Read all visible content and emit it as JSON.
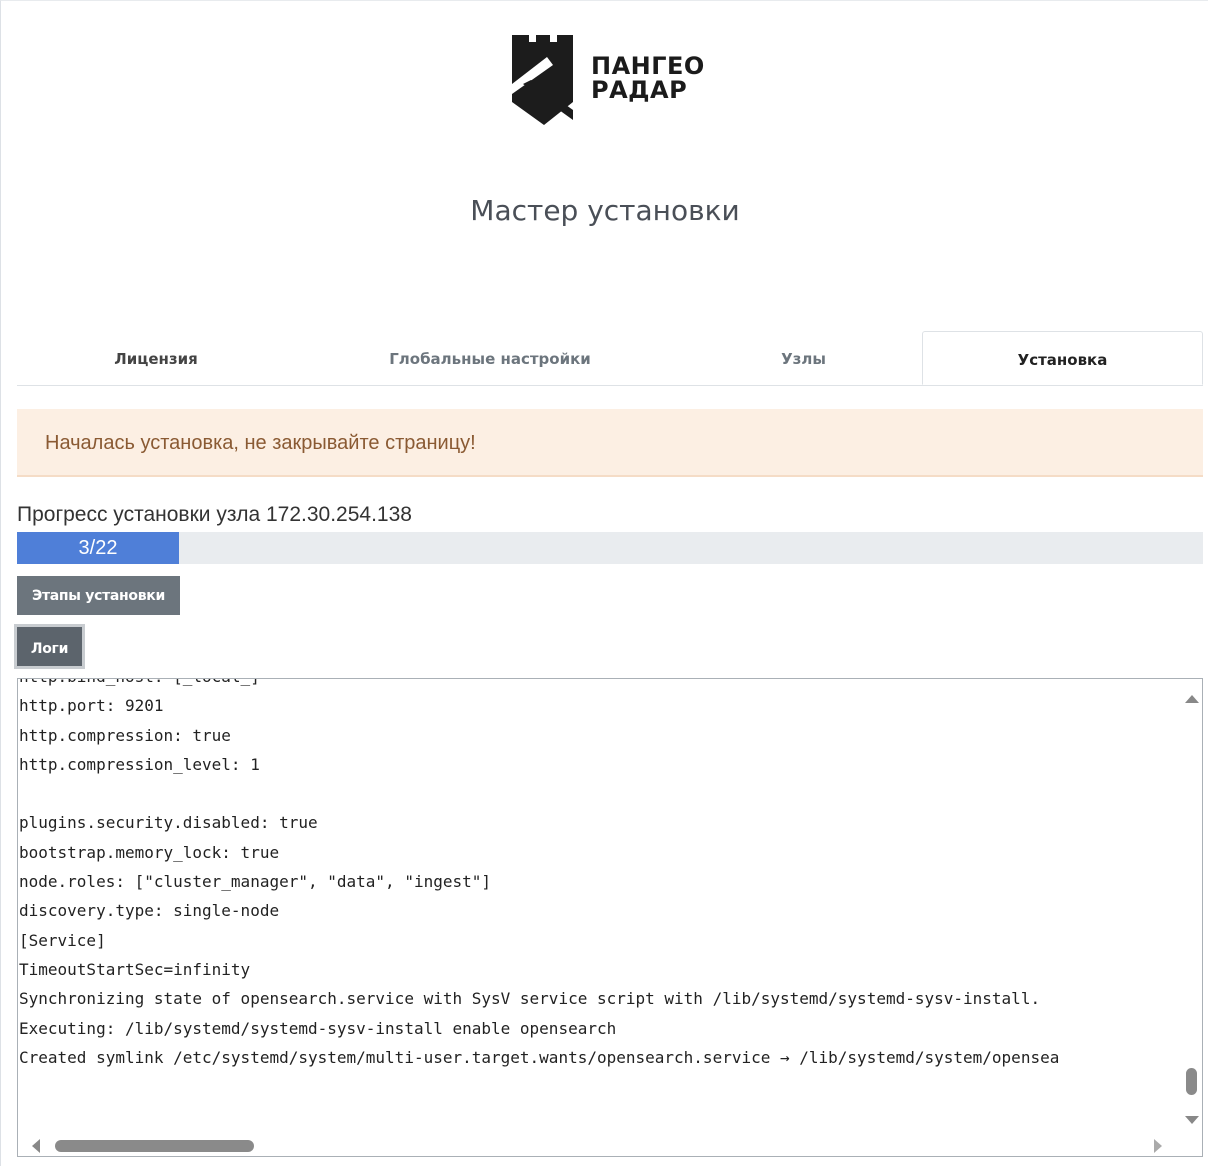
{
  "brand": {
    "line1": "ПАНГЕО",
    "line2": "РАДАР",
    "logo_icon": "tower-shield-logo"
  },
  "page_title": "Мастер установки",
  "tabs": [
    {
      "label": "Лицензия",
      "active": false
    },
    {
      "label": "Глобальные настройки",
      "active": false
    },
    {
      "label": "Узлы",
      "active": false
    },
    {
      "label": "Установка",
      "active": true
    }
  ],
  "alert": {
    "text": "Началась установка, не закрывайте страницу!",
    "background": "#fcefe3",
    "color": "#8a5a33"
  },
  "progress": {
    "label": "Прогресс установки узла 172.30.254.138",
    "text": "3/22",
    "current": 3,
    "total": 22,
    "fill_color": "#4f7fd8"
  },
  "buttons": {
    "stages": "Этапы установки",
    "logs": "Логи"
  },
  "logs": {
    "lines": [
      "http.bind_host: [_local_]",
      "http.port: 9201",
      "http.compression: true",
      "http.compression_level: 1",
      "",
      "plugins.security.disabled: true",
      "bootstrap.memory_lock: true",
      "node.roles: [\"cluster_manager\", \"data\", \"ingest\"]",
      "discovery.type: single-node",
      "[Service]",
      "TimeoutStartSec=infinity",
      "Synchronizing state of opensearch.service with SysV service script with /lib/systemd/systemd-sysv-install.",
      "Executing: /lib/systemd/systemd-sysv-install enable opensearch",
      "Created symlink /etc/systemd/system/multi-user.target.wants/opensearch.service → /lib/systemd/system/opensea"
    ]
  }
}
